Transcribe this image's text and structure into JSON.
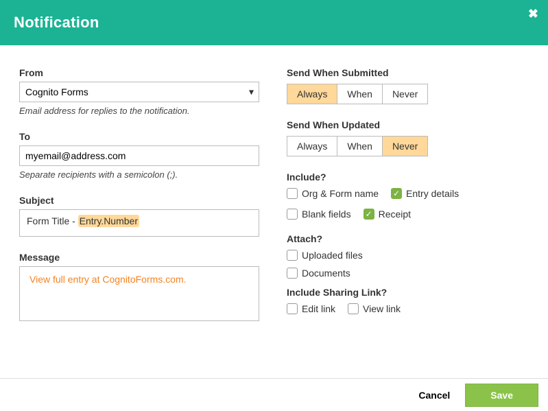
{
  "header": {
    "title": "Notification"
  },
  "from": {
    "label": "From",
    "value": "Cognito Forms",
    "hint": "Email address for replies to the notification."
  },
  "to": {
    "label": "To",
    "value": "myemail@address.com",
    "hint": "Separate recipients with a semicolon (;)."
  },
  "subject": {
    "label": "Subject",
    "prefix": "Form Title - ",
    "token": "Entry.Number"
  },
  "message": {
    "label": "Message",
    "link_text": "View full entry at CognitoForms.com."
  },
  "send_submitted": {
    "label": "Send When Submitted",
    "options": [
      "Always",
      "When",
      "Never"
    ],
    "selected": "Always"
  },
  "send_updated": {
    "label": "Send When Updated",
    "options": [
      "Always",
      "When",
      "Never"
    ],
    "selected": "Never"
  },
  "include": {
    "label": "Include?",
    "items": [
      {
        "label": "Org & Form name",
        "checked": false
      },
      {
        "label": "Entry details",
        "checked": true
      },
      {
        "label": "Blank fields",
        "checked": false
      },
      {
        "label": "Receipt",
        "checked": true
      }
    ]
  },
  "attach": {
    "label": "Attach?",
    "items": [
      {
        "label": "Uploaded files",
        "checked": false
      },
      {
        "label": "Documents",
        "checked": false
      }
    ]
  },
  "sharing": {
    "label": "Include Sharing Link?",
    "items": [
      {
        "label": "Edit link",
        "checked": false
      },
      {
        "label": "View link",
        "checked": false
      }
    ]
  },
  "footer": {
    "cancel": "Cancel",
    "save": "Save"
  }
}
